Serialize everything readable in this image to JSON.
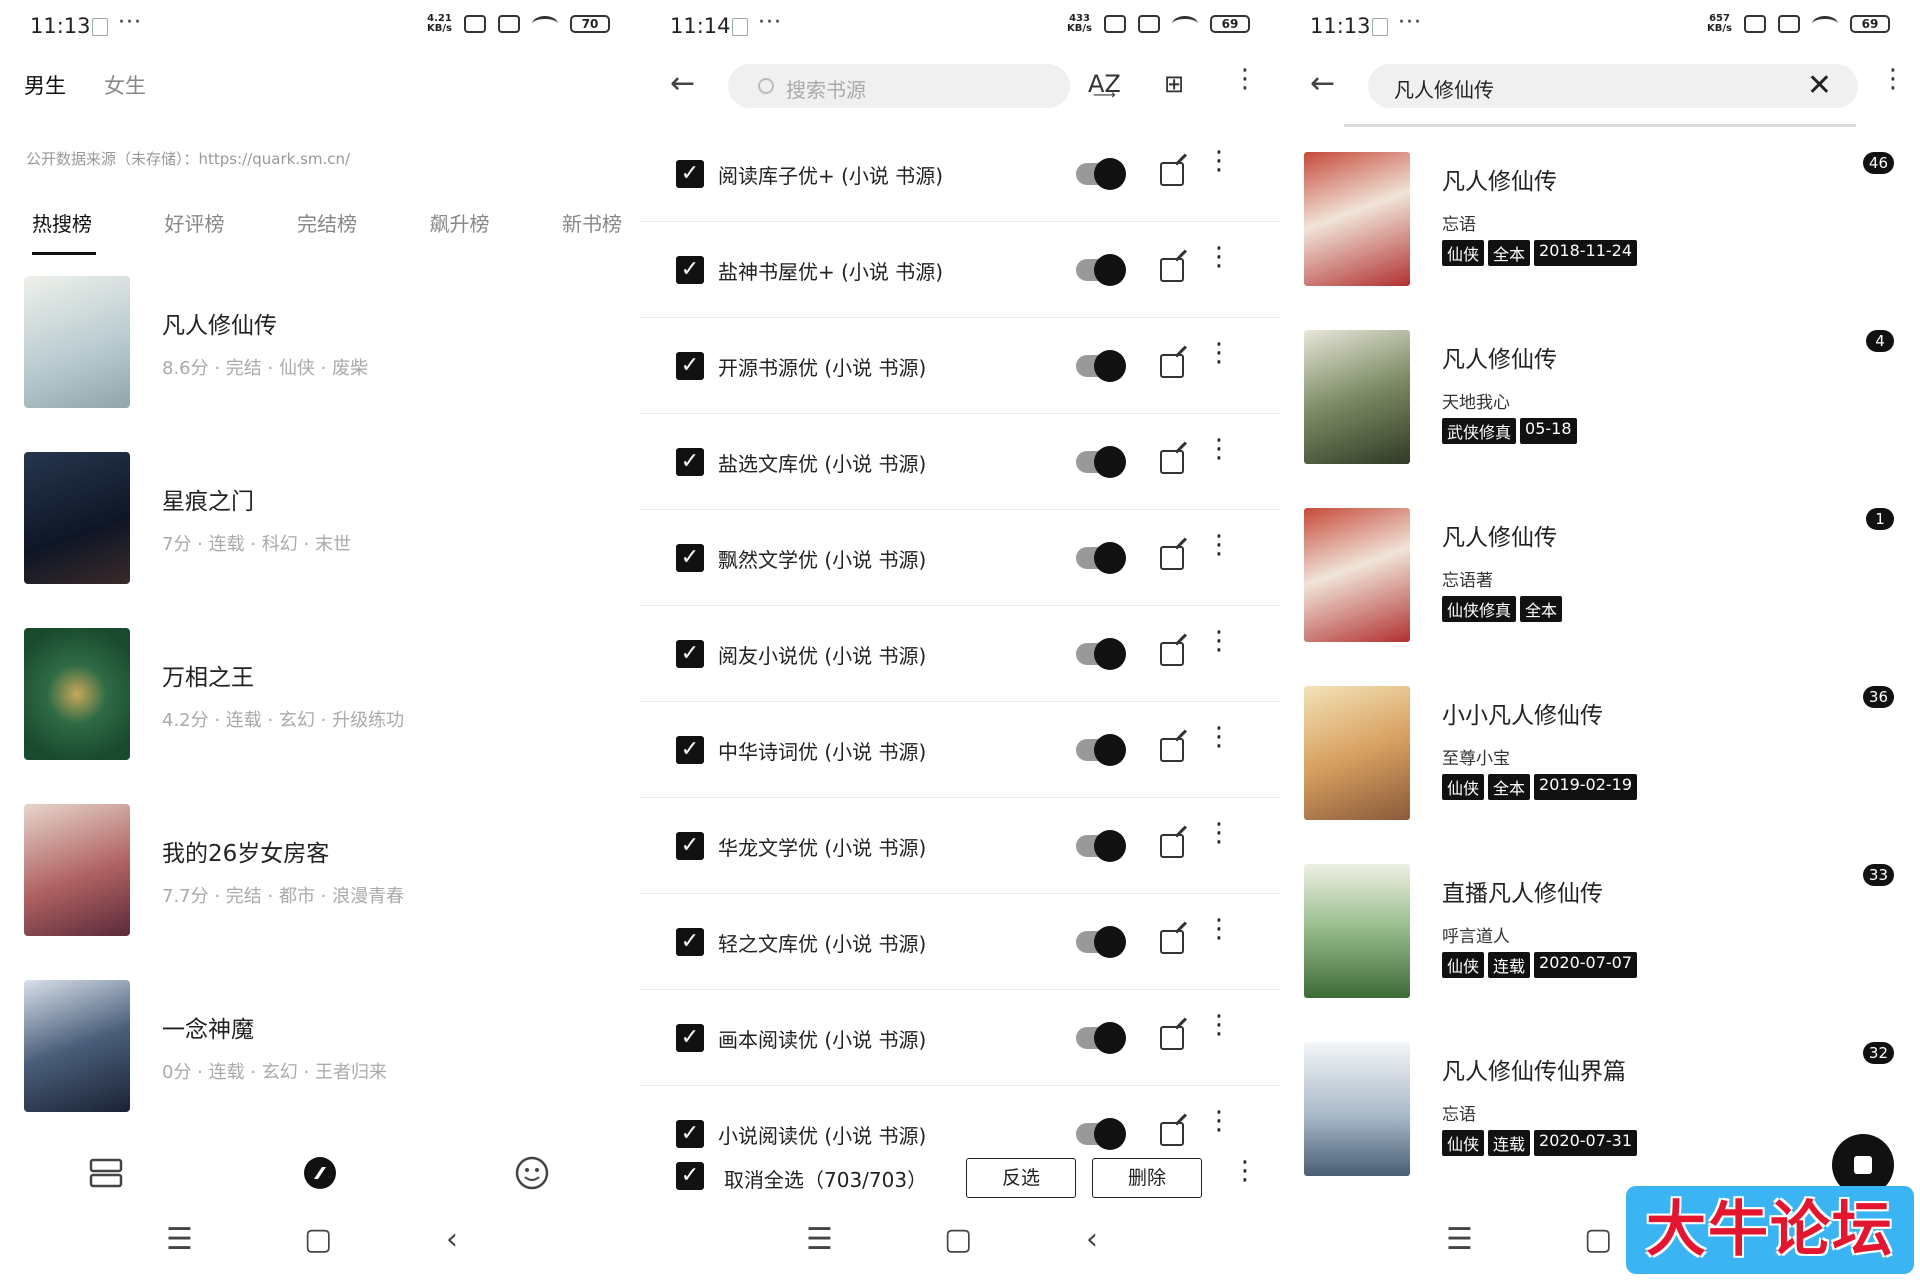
{
  "colors": {
    "accent": "#111111",
    "muted_text": "#aaaaaa",
    "watermark_bg": "#3ab4f2",
    "watermark_text": "#e4162f"
  },
  "panel1": {
    "status": {
      "time": "11:13",
      "speed_top": "4.21",
      "speed_bottom": "KB/s",
      "battery": "70"
    },
    "gender_tabs": [
      "男生",
      "女生"
    ],
    "source_note": "公开数据来源（未存储）：https://quark.sm.cn/",
    "rank_tabs": [
      "热搜榜",
      "好评榜",
      "完结榜",
      "飙升榜",
      "新书榜"
    ],
    "books": [
      {
        "title": "凡人修仙传",
        "meta": "8.6分 · 完结 · 仙侠 · 废柴",
        "cover_color": "#c9d6d8"
      },
      {
        "title": "星痕之门",
        "meta": "7分 · 连载 · 科幻 · 末世",
        "cover_color": "#1d2a3e"
      },
      {
        "title": "万相之王",
        "meta": "4.2分 · 连载 · 玄幻 · 升级练功",
        "cover_color": "#1f5a3a"
      },
      {
        "title": "我的26岁女房客",
        "meta": "7.7分 · 完结 · 都市 · 浪漫青春",
        "cover_color": "#8a4040"
      },
      {
        "title": "一念神魔",
        "meta": "0分 · 连载 · 玄幻 · 王者归来",
        "cover_color": "#2a3a52"
      }
    ],
    "app_nav": [
      "bookshelf-icon",
      "explore-icon",
      "profile-icon"
    ]
  },
  "panel2": {
    "status": {
      "time": "11:14",
      "speed_top": "433",
      "speed_bottom": "KB/s",
      "battery": "69"
    },
    "search_placeholder": "搜索书源",
    "sources": [
      "阅读库子优+ (小说 书源)",
      "盐神书屋优+ (小说 书源)",
      "开源书源优 (小说 书源)",
      "盐选文库优 (小说 书源)",
      "飘然文学优 (小说 书源)",
      "阅友小说优 (小说 书源)",
      "中华诗词优 (小说 书源)",
      "华龙文学优 (小说 书源)",
      "轻之文库优 (小说 书源)",
      "画本阅读优 (小说 书源)",
      "小说阅读优 (小说 书源)"
    ],
    "select_all_label": "取消全选（703/703）",
    "invert_label": "反选",
    "delete_label": "删除"
  },
  "panel3": {
    "status": {
      "time": "11:13",
      "speed_top": "657",
      "speed_bottom": "KB/s",
      "battery": "69"
    },
    "query": "凡人修仙传",
    "results": [
      {
        "title": "凡人修仙传",
        "author": "忘语",
        "tags": [
          "仙侠",
          "全本",
          "2018-11-24"
        ],
        "count": "46",
        "cover_color": "#a83a3a"
      },
      {
        "title": "凡人修仙传",
        "author": "天地我心",
        "tags": [
          "武侠修真",
          "05-18"
        ],
        "count": "4",
        "cover_color": "#6b7a58"
      },
      {
        "title": "凡人修仙传",
        "author": "忘语著",
        "tags": [
          "仙侠修真",
          "全本"
        ],
        "count": "1",
        "cover_color": "#a83a3a"
      },
      {
        "title": "小小凡人修仙传",
        "author": "至尊小宝",
        "tags": [
          "仙侠",
          "全本",
          "2019-02-19"
        ],
        "count": "36",
        "cover_color": "#d9b56a"
      },
      {
        "title": "直播凡人修仙传",
        "author": "呼言道人",
        "tags": [
          "仙侠",
          "连载",
          "2020-07-07"
        ],
        "count": "33",
        "cover_color": "#5f8a5a"
      },
      {
        "title": "凡人修仙传仙界篇",
        "author": "忘语",
        "tags": [
          "仙侠",
          "连载",
          "2020-07-31"
        ],
        "count": "32",
        "cover_color": "#7a8fa8"
      }
    ],
    "watermark": "大牛论坛"
  }
}
